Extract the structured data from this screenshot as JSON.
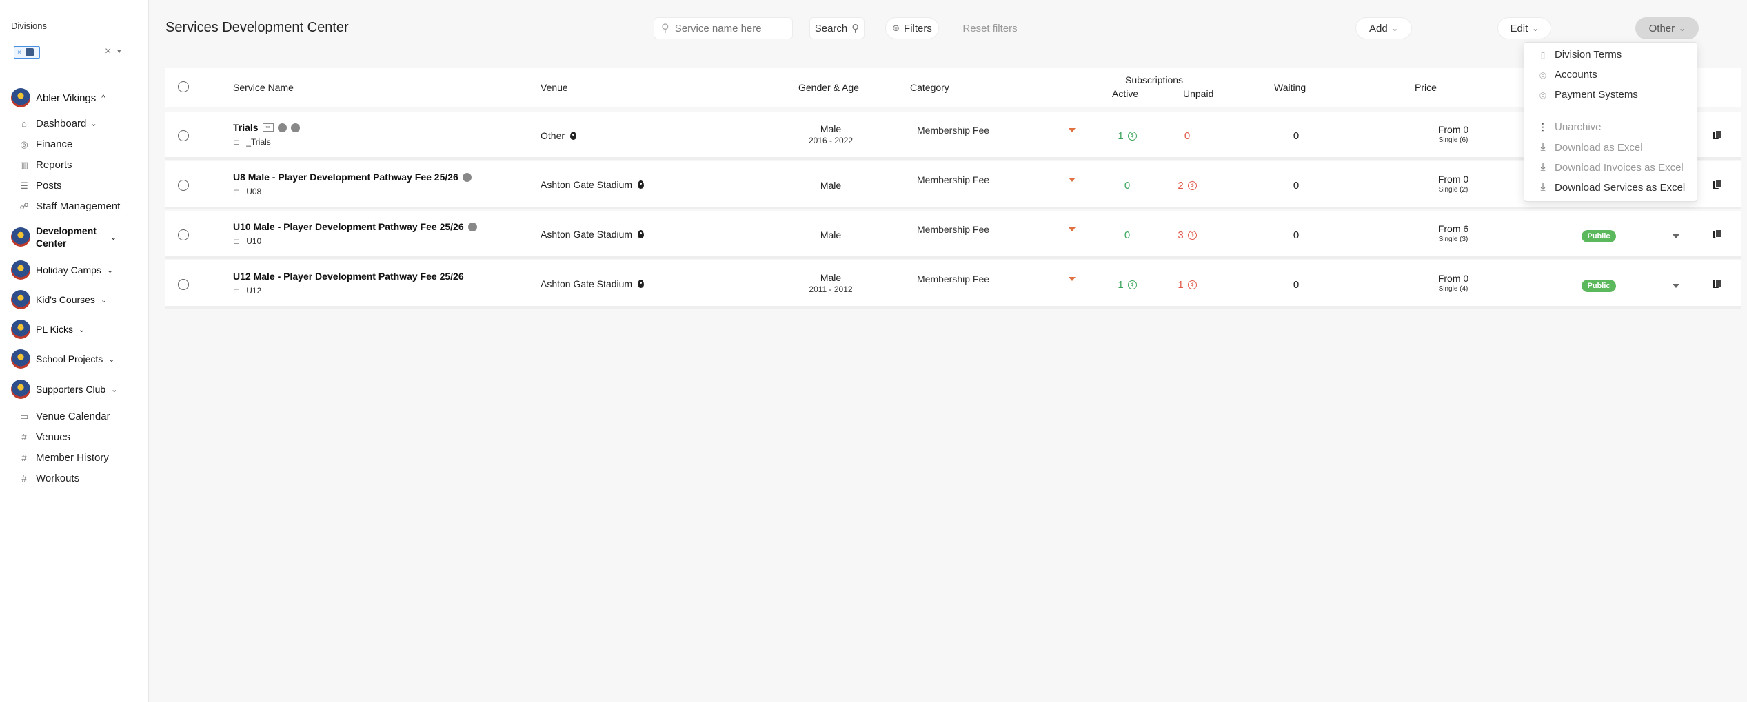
{
  "sidebar": {
    "divisions_label": "Divisions",
    "selected_tag_close": "×",
    "select_clear": "×",
    "org": {
      "name": "Abler Vikings"
    },
    "org_nav": [
      {
        "label": "Dashboard",
        "icon": "home-icon"
      },
      {
        "label": "Finance",
        "icon": "coin-icon"
      },
      {
        "label": "Reports",
        "icon": "bar-chart-icon"
      },
      {
        "label": "Posts",
        "icon": "posts-icon"
      },
      {
        "label": "Staff Management",
        "icon": "staff-icon"
      }
    ],
    "divisions": [
      {
        "label": "Development Center"
      },
      {
        "label": "Holiday Camps"
      },
      {
        "label": "Kid's Courses"
      },
      {
        "label": "PL Kicks"
      },
      {
        "label": "School Projects"
      },
      {
        "label": "Supporters Club"
      }
    ],
    "bottom_nav": [
      {
        "label": "Venue Calendar",
        "icon": "calendar-icon"
      },
      {
        "label": "Venues",
        "icon": "hash-icon"
      },
      {
        "label": "Member History",
        "icon": "hash-icon"
      },
      {
        "label": "Workouts",
        "icon": "hash-icon"
      }
    ]
  },
  "header": {
    "title": "Services Development Center",
    "search_placeholder": "Service name here",
    "search_button": "Search",
    "filters_button": "Filters",
    "reset_button": "Reset filters",
    "add_button": "Add",
    "edit_button": "Edit",
    "other_button": "Other"
  },
  "table": {
    "columns": {
      "service_name": "Service Name",
      "venue": "Venue",
      "gender_age": "Gender & Age",
      "category": "Category",
      "subscriptions": "Subscriptions",
      "active": "Active",
      "unpaid": "Unpaid",
      "waiting": "Waiting",
      "price": "Price"
    },
    "rows": [
      {
        "name": "Trials",
        "sub": "_Trials",
        "venue": "Other",
        "gender": "Male",
        "years": "2016 - 2022",
        "category": "Membership Fee",
        "active": "1",
        "unpaid": "0",
        "waiting": "0",
        "price": "From 0",
        "single": "Single (6)",
        "visibility": ""
      },
      {
        "name": "U8 Male - Player Development Pathway Fee 25/26",
        "sub": "U08",
        "venue": "Ashton Gate Stadium",
        "gender": "Male",
        "years": "",
        "category": "Membership Fee",
        "active": "0",
        "unpaid": "2",
        "waiting": "0",
        "price": "From 0",
        "single": "Single (2)",
        "visibility": ""
      },
      {
        "name": "U10 Male - Player Development Pathway Fee 25/26",
        "sub": "U10",
        "venue": "Ashton Gate Stadium",
        "gender": "Male",
        "years": "",
        "category": "Membership Fee",
        "active": "0",
        "unpaid": "3",
        "waiting": "0",
        "price": "From 6",
        "single": "Single (3)",
        "visibility": "Public"
      },
      {
        "name": "U12 Male - Player Development Pathway Fee 25/26",
        "sub": "U12",
        "venue": "Ashton Gate Stadium",
        "gender": "Male",
        "years": "2011 - 2012",
        "category": "Membership Fee",
        "active": "1",
        "unpaid": "1",
        "waiting": "0",
        "price": "From 0",
        "single": "Single (4)",
        "visibility": "Public"
      }
    ]
  },
  "other_menu": {
    "items_top": [
      {
        "label": "Division Terms",
        "icon": "document-icon"
      },
      {
        "label": "Accounts",
        "icon": "coin-icon"
      },
      {
        "label": "Payment Systems",
        "icon": "coin-icon"
      }
    ],
    "items_bottom": [
      {
        "label": "Unarchive",
        "icon": "more-vertical-icon"
      },
      {
        "label": "Download as Excel",
        "icon": "download-icon"
      },
      {
        "label": "Download Invoices as Excel",
        "icon": "download-icon"
      },
      {
        "label": "Download Services as Excel",
        "icon": "download-icon"
      }
    ]
  },
  "colors": {
    "active_green": "#3ba55d",
    "unpaid_red": "#e05a4a",
    "public_badge": "#5cb85c",
    "category_caret": "#e07040"
  }
}
